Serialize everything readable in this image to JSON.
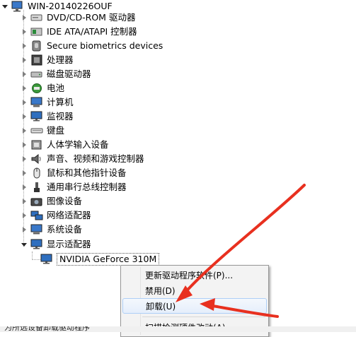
{
  "root": {
    "label": "WIN-20140226OUF"
  },
  "categories": [
    {
      "label": "DVD/CD-ROM 驱动器",
      "icon": "dvd-drive-icon"
    },
    {
      "label": "IDE ATA/ATAPI 控制器",
      "icon": "ide-controller-icon"
    },
    {
      "label": "Secure biometrics devices",
      "icon": "biometrics-icon"
    },
    {
      "label": "处理器",
      "icon": "processor-icon"
    },
    {
      "label": "磁盘驱动器",
      "icon": "disk-drive-icon"
    },
    {
      "label": "电池",
      "icon": "battery-icon"
    },
    {
      "label": "计算机",
      "icon": "computer-icon"
    },
    {
      "label": "监视器",
      "icon": "monitor-icon"
    },
    {
      "label": "键盘",
      "icon": "keyboard-icon"
    },
    {
      "label": "人体学输入设备",
      "icon": "hid-icon"
    },
    {
      "label": "声音、视频和游戏控制器",
      "icon": "sound-icon"
    },
    {
      "label": "鼠标和其他指针设备",
      "icon": "mouse-icon"
    },
    {
      "label": "通用串行总线控制器",
      "icon": "usb-icon"
    },
    {
      "label": "图像设备",
      "icon": "camera-icon"
    },
    {
      "label": "网络适配器",
      "icon": "network-adapter-icon"
    },
    {
      "label": "系统设备",
      "icon": "system-device-icon"
    },
    {
      "label": "显示适配器",
      "icon": "display-adapter-icon"
    }
  ],
  "selected_device": {
    "label": "NVIDIA GeForce 310M"
  },
  "context_menu": {
    "items": [
      {
        "label": "更新驱动程序软件(P)..."
      },
      {
        "label": "禁用(D)"
      },
      {
        "label": "卸载(U)"
      },
      {
        "label": "扫描检测硬件改动(A)"
      }
    ]
  },
  "statusbar": {
    "text": "为所选设备卸载驱动程序"
  },
  "colors": {
    "arrow": "#e8301f",
    "highlight_border": "#aecff7"
  }
}
